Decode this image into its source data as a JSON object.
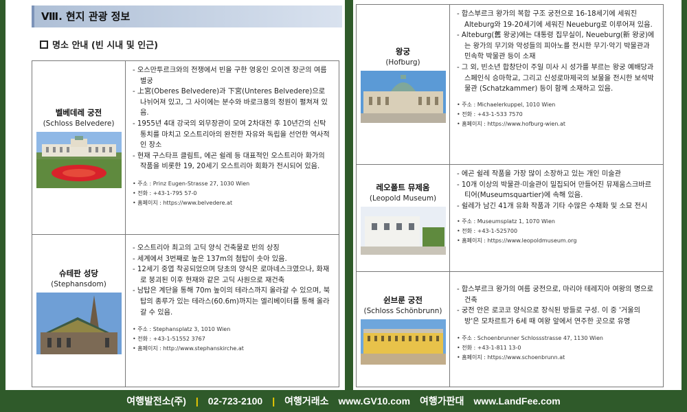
{
  "section_title": "Ⅷ. 현지 관광 정보",
  "sub_heading": "명소 안내 (빈 시내 및 인근)",
  "left_items": [
    {
      "name_ko": "벨베데레 궁전",
      "name_en": "(Schloss Belvedere)",
      "bullets": [
        "- 오스만투르크와의 전쟁에서 빈을 구한 영웅인 오이겐 장군의 여름 별궁",
        "- 上宮(Oberes Belvedere)과 下宮(Unteres Belvedere)으로 나뉘어져 있고, 그 사이에는 분수와 바로크풍의 정원이 펼쳐져 있음.",
        "- 1955년 4대 강국의 외무장관이 모여 2차대전 후 10년간의 신탁통치를 마치고 오스트리아의 완전한 자유와 독립을 선언한 역사적인 장소",
        "- 현재 구스타프 클림트, 에곤 쉴레 등 대표적인 오스트리아 화가의 작품을 비롯한 19, 20세기 오스트리아 회화가 전시되어 있음."
      ],
      "address": "주소 : Prinz Eugen-Strasse 27, 1030 Wien",
      "phone": "전화 : +43-1-795 57-0",
      "web": "홈페이지 : https://www.belvedere.at"
    },
    {
      "name_ko": "슈테판 성당",
      "name_en": "(Stephansdom)",
      "bullets": [
        "- 오스트리아 최고의 고딕 양식 건축물로 빈의 상징",
        "- 세계에서 3번째로 높은 137m의 첨탑이 솟아 있음.",
        "- 12세기 중엽 착공되었으며 당초의 양식은 로마네스크였으나, 화재로 붕괴된 이후 현재와 같은 고딕 사원으로 재건축",
        "- 남탑은 계단을 통해 70m 높이의 테라스까지 올라갈 수 있으며, 북탑의 종루가 있는 테라스(60.6m)까지는 엘리베이터를 통해 올라갈 수 있음."
      ],
      "address": "주소 : Stephansplatz 3, 1010 Wien",
      "phone": "전화 : +43-1-51552 3767",
      "web": "홈페이지 : http://www.stephanskirche.at"
    }
  ],
  "right_items": [
    {
      "name_ko": "왕궁",
      "name_en": "(Hofburg)",
      "bullets": [
        "- 합스부르크 왕가의 복합 구조 궁전으로 16-18세기에 세워진 Alteburg와 19-20세기에 세워진 Neueburg로 이루어져 있음.",
        "- Alteburg(舊 왕궁)에는 대통령 집무실이, Neueburg(新 왕궁)에는 왕가의 무기와 악성들의 피아노를 전시한 무기·악기 박물관과 민속학 박물관 등이 소재",
        "- 그 외, 빈소년 합창단이 주일 미사 시 성가를 부르는 왕궁 예배당과 스페인식 승마학교, 그리고 신성로마제국의 보물을 전시한 보석박물관 (Schatzkammer) 등이 함께 소재하고 있음."
      ],
      "address": "주소 : Michaelerkuppel, 1010 Wien",
      "phone": "전화 : +43-1-533 7570",
      "web": "홈페이지 : https://www.hofburg-wien.at"
    },
    {
      "name_ko": "레오폴트 뮤제움",
      "name_en": "(Leopold Museum)",
      "bullets": [
        "- 에곤 쉴레 작품을 가장 많이 소장하고 있는 개인 미술관",
        "- 10개 이상의 박물관·미술관이 밀집되어 만들어진 뮤제움스크바르티어(Museumsquartier)에 속해 있음.",
        "- 쉴레가 남긴 41개 유화 작품과 기타 수많은 수채화 및 소묘 전시"
      ],
      "address": "주소 : Museumsplatz 1, 1070 Wien",
      "phone": "전화 : +43-1-525700",
      "web": "홈페이지 : https://www.leopoldmuseum.org"
    },
    {
      "name_ko": "쉰브룬 궁전",
      "name_en": "(Schloss Schönbrunn)",
      "bullets": [
        "- 합스부르크 왕가의 여름 궁전으로, 마리아 테레지아 여왕의 명으로 건축",
        "- 궁전 안은 로코코 양식으로 장식된 방들로 구성. 이 중 '거울의 방'은 모차르트가 6세 때 여왕 앞에서 연주한 곳으로 유명"
      ],
      "address": "주소 : Schoenbrunner Schlossstrasse 47, 1130 Wien",
      "phone": "전화 : +43-1-811 13-0",
      "web": "홈페이지 : https://www.schoenbrunn.at"
    }
  ],
  "footer": {
    "company": "여행발전소(주)",
    "phone": "02-723-2100",
    "label1": "여행거래소",
    "site1": "www.GV10.com",
    "label2": "여행가판대",
    "site2": "www.LandFee.com"
  }
}
